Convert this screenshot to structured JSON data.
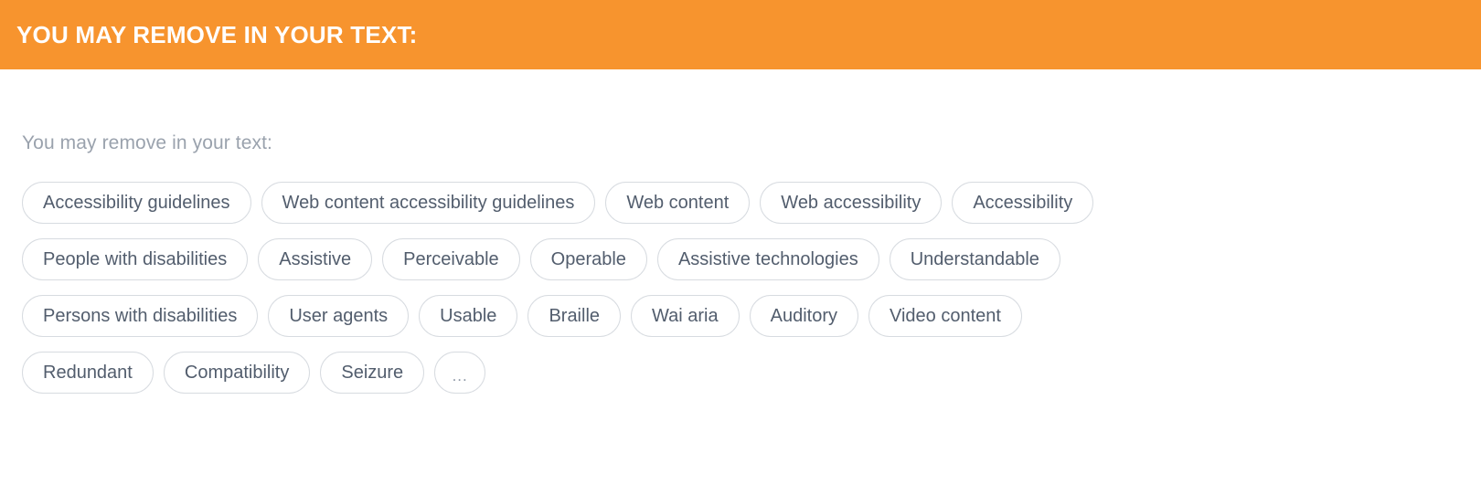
{
  "banner": {
    "title": "YOU MAY REMOVE IN YOUR TEXT:",
    "background_color": "#f7942e",
    "text_color": "#ffffff"
  },
  "content": {
    "subtitle": "You may remove in your text:",
    "subtitle_color": "#9aa2ad",
    "chip_border_color": "#d7dbe0",
    "chip_text_color": "#525d6d",
    "chip_rows": [
      [
        "Accessibility guidelines",
        "Web content accessibility guidelines",
        "Web content",
        "Web accessibility",
        "Accessibility"
      ],
      [
        "People with disabilities",
        "Assistive",
        "Perceivable",
        "Operable",
        "Assistive technologies",
        "Understandable"
      ],
      [
        "Persons with disabilities",
        "User agents",
        "Usable",
        "Braille",
        "Wai aria",
        "Auditory",
        "Video content"
      ],
      [
        "Redundant",
        "Compatibility",
        "Seizure",
        "..."
      ]
    ]
  }
}
